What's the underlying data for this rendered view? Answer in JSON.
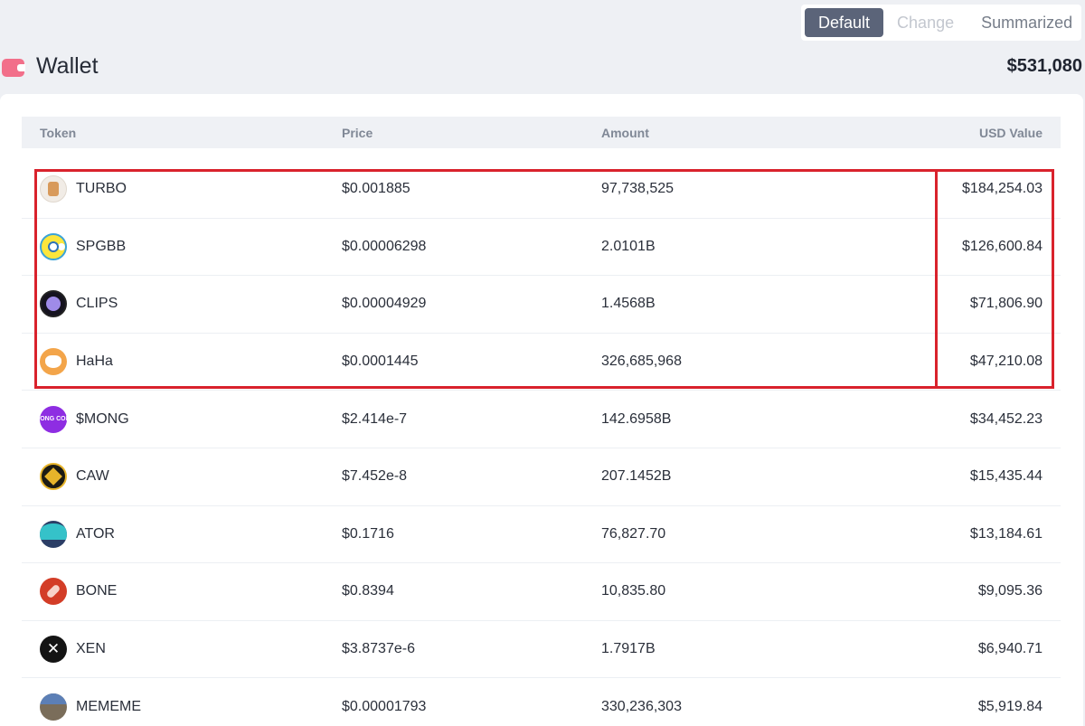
{
  "view_modes": {
    "default": "Default",
    "change": "Change",
    "summarized": "Summarized"
  },
  "wallet": {
    "title": "Wallet",
    "total": "$531,080"
  },
  "table": {
    "headers": {
      "token": "Token",
      "price": "Price",
      "amount": "Amount",
      "usd_value": "USD Value"
    },
    "rows": [
      {
        "token": "TURBO",
        "price": "$0.001885",
        "amount": "97,738,525",
        "usd": "$184,254.03"
      },
      {
        "token": "SPGBB",
        "price": "$0.00006298",
        "amount": "2.0101B",
        "usd": "$126,600.84"
      },
      {
        "token": "CLIPS",
        "price": "$0.00004929",
        "amount": "1.4568B",
        "usd": "$71,806.90"
      },
      {
        "token": "HaHa",
        "price": "$0.0001445",
        "amount": "326,685,968",
        "usd": "$47,210.08"
      },
      {
        "token": "$MONG",
        "price": "$2.414e-7",
        "amount": "142.6958B",
        "usd": "$34,452.23",
        "icon_text": "MONG COIN"
      },
      {
        "token": "CAW",
        "price": "$7.452e-8",
        "amount": "207.1452B",
        "usd": "$15,435.44"
      },
      {
        "token": "ATOR",
        "price": "$0.1716",
        "amount": "76,827.70",
        "usd": "$13,184.61"
      },
      {
        "token": "BONE",
        "price": "$0.8394",
        "amount": "10,835.80",
        "usd": "$9,095.36"
      },
      {
        "token": "XEN",
        "price": "$3.8737e-6",
        "amount": "1.7917B",
        "usd": "$6,940.71"
      },
      {
        "token": "MEMEME",
        "price": "$0.00001793",
        "amount": "330,236,303",
        "usd": "$5,919.84"
      }
    ]
  },
  "icons": {
    "turbo": "turbo-token-icon",
    "spgbb": "spgbb-token-icon",
    "clips": "clips-token-icon",
    "haha": "haha-token-icon",
    "mong": "mong-token-icon",
    "caw": "caw-token-icon",
    "ator": "ator-token-icon",
    "bone": "bone-token-icon",
    "xen": "xen-token-icon",
    "meme": "mememe-token-icon"
  },
  "colors": {
    "accent_active": "#5b6479",
    "highlight": "#d9222c",
    "wallet_icon": "#f26f8a"
  }
}
